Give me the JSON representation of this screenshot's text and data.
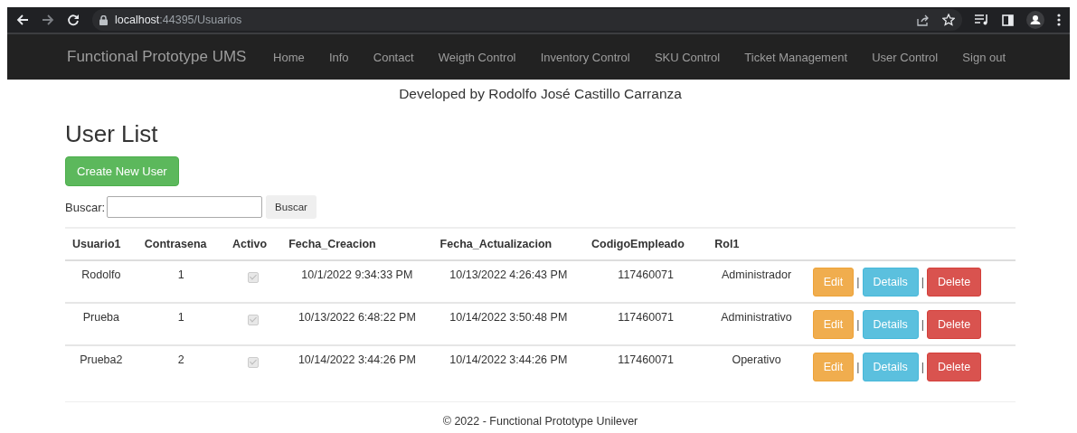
{
  "browser": {
    "url_host": "localhost",
    "url_rest": ":44395/Usuarios"
  },
  "navbar": {
    "brand": "Functional Prototype UMS",
    "links": [
      "Home",
      "Info",
      "Contact",
      "Weigth Control",
      "Inventory Control",
      "SKU Control",
      "Ticket Management",
      "User Control",
      "Sign out"
    ]
  },
  "developer_note": "Developed by Rodolfo José Castillo Carranza",
  "title": "User List",
  "create_button": "Create New User",
  "search": {
    "label": "Buscar:",
    "button": "Buscar"
  },
  "table": {
    "columns": [
      "Usuario1",
      "Contrasena",
      "Activo",
      "Fecha_Creacion",
      "Fecha_Actualizacion",
      "CodigoEmpleado",
      "Rol1"
    ],
    "rows": [
      {
        "usuario": "Rodolfo",
        "contrasena": "1",
        "activo": true,
        "fecha_creacion": "10/1/2022 9:34:33 PM",
        "fecha_actualizacion": "10/13/2022 4:26:43 PM",
        "codigo": "117460071",
        "rol": "Administrador",
        "actions": [
          "Edit",
          "|",
          "Details",
          "|",
          "Delete"
        ]
      },
      {
        "usuario": "Prueba",
        "contrasena": "1",
        "activo": true,
        "fecha_creacion": "10/13/2022 6:48:22 PM",
        "fecha_actualizacion": "10/14/2022 3:50:48 PM",
        "codigo": "117460071",
        "rol": "Administrativo",
        "actions": [
          "Edit",
          "|",
          "Details",
          "|",
          "Delete"
        ]
      },
      {
        "usuario": "Prueba2",
        "contrasena": "2",
        "activo": true,
        "fecha_creacion": "10/14/2022 3:44:26 PM",
        "fecha_actualizacion": "10/14/2022 3:44:26 PM",
        "codigo": "117460071",
        "rol": "Operativo",
        "actions": [
          "Edit",
          "|",
          "Details",
          "|",
          "Delete"
        ]
      }
    ]
  },
  "footer": "© 2022 - Functional Prototype Unilever"
}
